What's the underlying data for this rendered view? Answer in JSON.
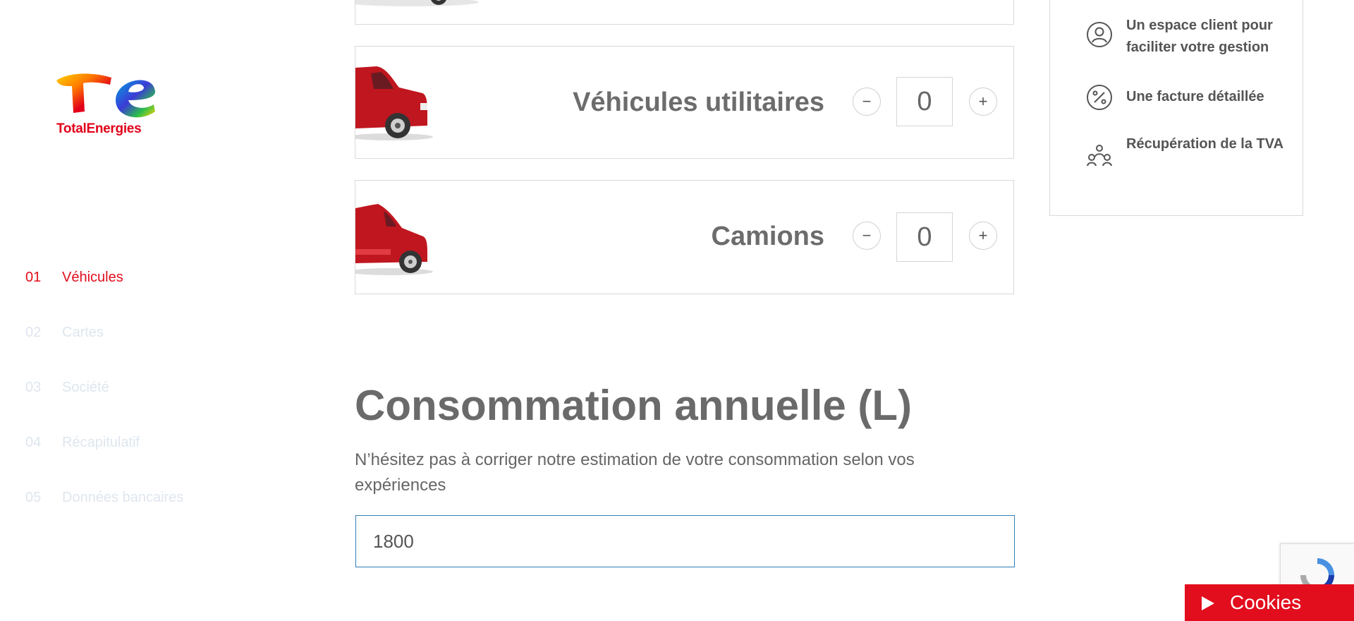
{
  "brand": {
    "name": "TotalEnergies"
  },
  "steps": [
    {
      "num": "01",
      "label": "Véhicules"
    },
    {
      "num": "02",
      "label": "Cartes"
    },
    {
      "num": "03",
      "label": "Société"
    },
    {
      "num": "04",
      "label": "Récapitulatif"
    },
    {
      "num": "05",
      "label": "Données bancaires"
    }
  ],
  "vehicles": {
    "utility": {
      "label": "Véhicules utilitaires",
      "value": "0",
      "minus": "−",
      "plus": "+"
    },
    "trucks": {
      "label": "Camions",
      "value": "0",
      "minus": "−",
      "plus": "+"
    }
  },
  "consumption": {
    "title": "Consommation annuelle (L)",
    "description": "N’hésitez pas à corriger notre estimation de votre consommation selon vos expériences",
    "value": "1800"
  },
  "benefits": [
    {
      "icon": "user-circle-icon",
      "text": "Un espace client pour faciliter votre gestion"
    },
    {
      "icon": "percent-icon",
      "text": "Une facture détaillée"
    },
    {
      "icon": "group-icon",
      "text": "Récupération de la TVA"
    }
  ],
  "cookies": {
    "label": "Cookies"
  },
  "colors": {
    "accent": "#e20d1d",
    "input_border": "#2f7fb8",
    "inactive_step": "#dfe6ee"
  }
}
